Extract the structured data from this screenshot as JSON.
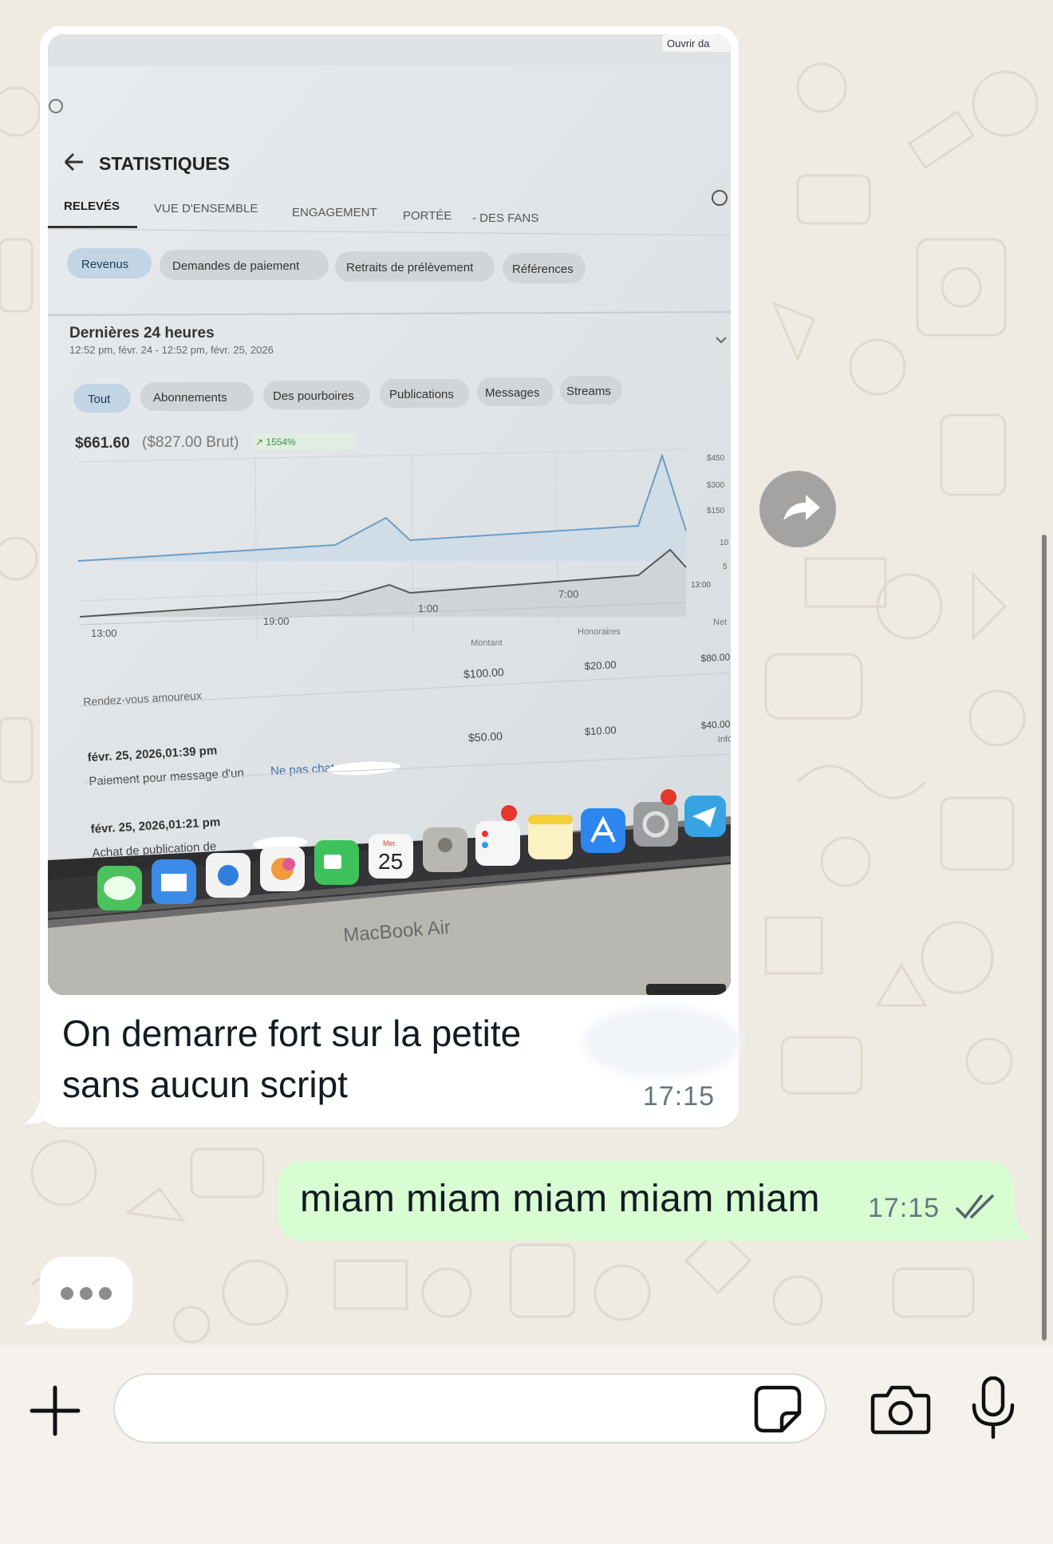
{
  "chat": {
    "incoming": {
      "caption_line1": "On demarre fort sur la petite",
      "caption_line2": "sans aucun script",
      "time": "17:15"
    },
    "outgoing": {
      "text": "miam miam miam miam miam",
      "time": "17:15",
      "status": "read"
    },
    "typing_indicator": true
  },
  "photo": {
    "ouvrir_label": "Ouvrir da",
    "page_title": "STATISTIQUES",
    "tabs": [
      "RELEVÉS",
      "VUE D'ENSEMBLE",
      "ENGAGEMENT",
      "PORTÉE",
      "- DES FANS"
    ],
    "filter_chips": [
      "Revenus",
      "Demandes de paiement",
      "Retraits de prélèvement",
      "Références"
    ],
    "period_title": "Dernières 24 heures",
    "period_range": "12:52 pm, févr. 24 - 12:52 pm, févr. 25, 2026",
    "category_chips": [
      "Tout",
      "Abonnements",
      "Des pourboires",
      "Publications",
      "Messages",
      "Streams"
    ],
    "net_total": "$661.60",
    "gross_total": "($827.00 Brut)",
    "growth": "↗ 1554%",
    "y_ticks_top": [
      "$450",
      "$300",
      "$150"
    ],
    "y_ticks_bottom": [
      "10",
      "5"
    ],
    "x_ticks": [
      "13:00",
      "19:00",
      "1:00",
      "7:00",
      "13:00"
    ],
    "table_headers": [
      "Montant",
      "Honoraires",
      "Net"
    ],
    "rows": [
      {
        "label": "Rendez-vous amoureux",
        "date": "",
        "desc": "",
        "amount": "$100.00",
        "fee": "$20.00",
        "net": "$80.00"
      },
      {
        "label": "",
        "date": "févr. 25, 2026,01:39 pm",
        "desc": "Paiement pour message d'un",
        "link": "Ne pas chat",
        "amount": "$50.00",
        "fee": "$10.00",
        "net": "$40.00"
      },
      {
        "label": "",
        "date": "févr. 25, 2026,01:21 pm",
        "desc": "Achat de publication de",
        "amount": "",
        "fee": "",
        "net": ""
      }
    ],
    "row_extra": "Info",
    "calendar_month": "Mer.",
    "calendar_day": "25",
    "laptop_label": "MacBook Air"
  },
  "input": {
    "placeholder": ""
  },
  "colors": {
    "chat_background": "#efeae2",
    "incoming_bubble": "#ffffff",
    "outgoing_bubble": "#d9fdd3",
    "read_ticks": "#53636c",
    "chart_line": "#6a9ec8"
  },
  "icons": {
    "forward": "forward-arrow-icon",
    "plus": "plus-icon",
    "sticker": "sticker-icon",
    "camera": "camera-icon",
    "mic": "microphone-icon",
    "ticks": "double-check-icon"
  }
}
